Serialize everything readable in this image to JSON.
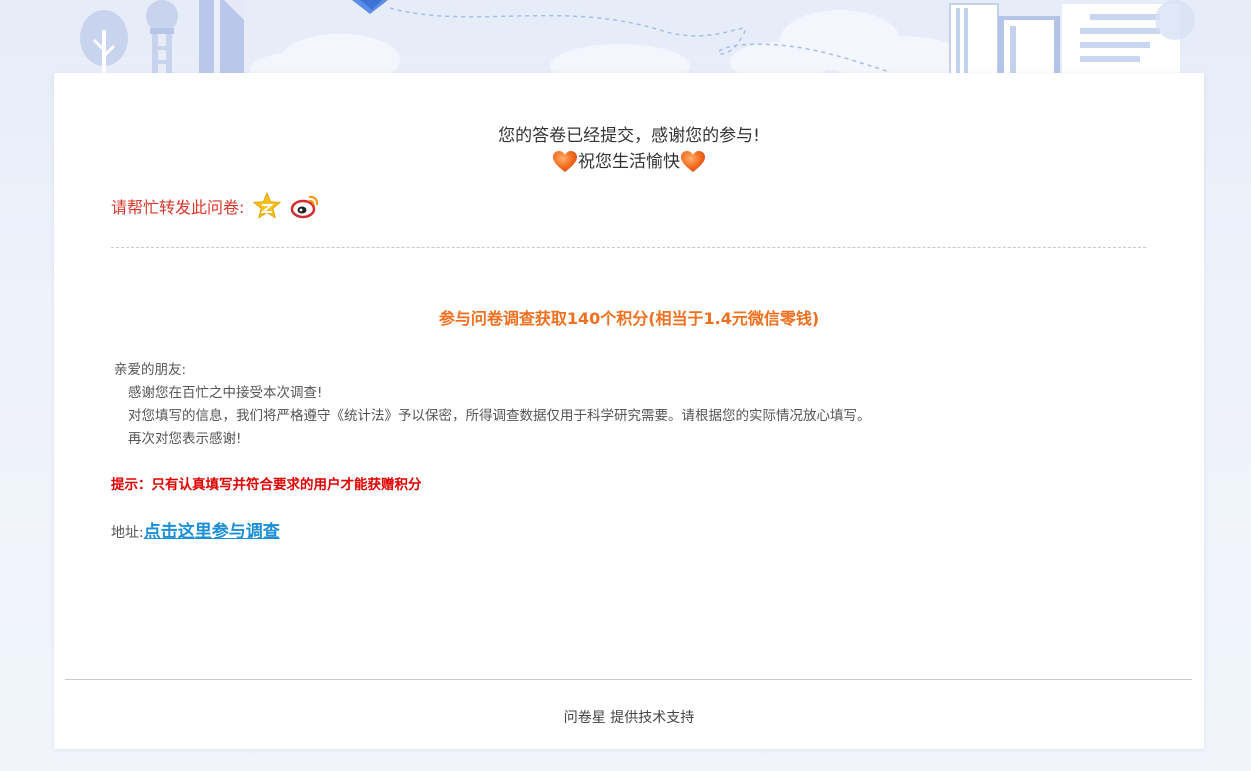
{
  "result": {
    "submitted_text": "您的答卷已经提交，感谢您的参与!",
    "wish_text": "祝您生活愉快"
  },
  "share": {
    "label": "请帮忙转发此问卷:",
    "icons": [
      "qzone-star-icon",
      "weibo-icon"
    ]
  },
  "promo": {
    "headline": "参与问卷调查获取140个积分(相当于1.4元微信零钱)",
    "greeting": "亲爱的朋友:",
    "line1": "感谢您在百忙之中接受本次调查!",
    "line2": "对您填写的信息，我们将严格遵守《统计法》予以保密，所得调查数据仅用于科学研究需要。请根据您的实际情况放心填写。",
    "line3": "再次对您表示感谢!",
    "tip": "提示：只有认真填写并符合要求的用户才能获赠积分",
    "address_label": "地址:",
    "address_link": "点击这里参与调查"
  },
  "footer": {
    "text": "问卷星 提供技术支持"
  },
  "colors": {
    "accent_orange": "#f07020",
    "tip_red": "#e00000",
    "link_blue": "#1b8fd6",
    "share_red": "#d9352a"
  }
}
